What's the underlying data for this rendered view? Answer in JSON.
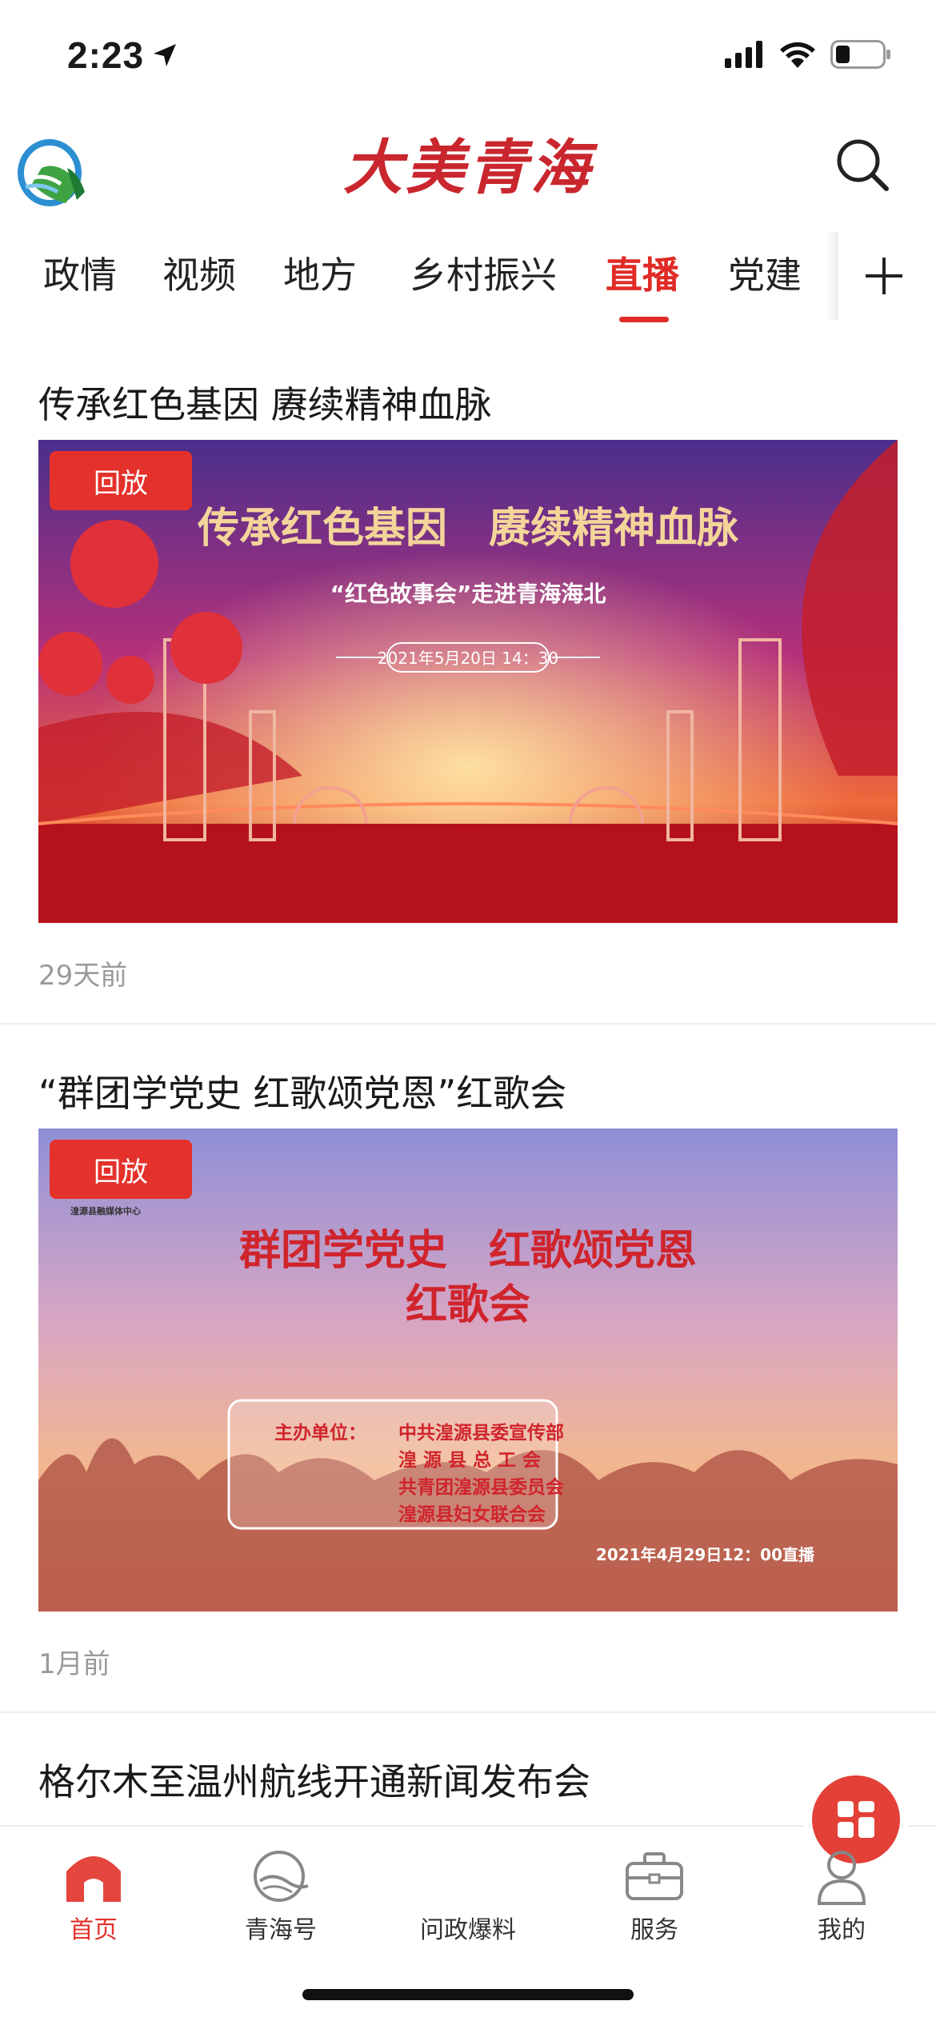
{
  "status_bar": {
    "time": "2:23"
  },
  "header": {
    "brand": "大美青海"
  },
  "tabs": [
    {
      "label": "政情"
    },
    {
      "label": "视频"
    },
    {
      "label": "地方"
    },
    {
      "label": "乡村振兴"
    },
    {
      "label": "直播"
    },
    {
      "label": "党建"
    }
  ],
  "active_tab": "直播",
  "feed": [
    {
      "title": "传承红色基因 赓续精神血脉",
      "badge": "回放",
      "time": "29天前",
      "banner": {
        "headline": "传承红色基因　赓续精神血脉",
        "subtitle": "“红色故事会”走进青海海北",
        "datetime": "2021年5月20日 14：30"
      }
    },
    {
      "title": "“群团学党史 红歌颂党恩”红歌会",
      "badge": "回放",
      "time": "1月前",
      "banner": {
        "org": "湟源县融媒体中心",
        "headline_1": "群团学党史　红歌颂党恩",
        "headline_2": "红歌会",
        "host_label": "主办单位：",
        "hosts": [
          "中共湟源县委宣传部",
          "湟 源 县 总 工 会",
          "共青团湟源县委员会",
          "湟源县妇女联合会"
        ],
        "datetime": "2021年4月29日12：00直播"
      }
    },
    {
      "title": "格尔木至温州航线开通新闻发布会"
    }
  ],
  "bottom_nav": [
    {
      "label": "首页",
      "icon": "home-icon",
      "active": true
    },
    {
      "label": "青海号",
      "icon": "qinghai-account-icon"
    },
    {
      "label": "问政爆料",
      "icon": "report-icon"
    },
    {
      "label": "服务",
      "icon": "briefcase-icon"
    },
    {
      "label": "我的",
      "icon": "user-icon"
    }
  ],
  "colors": {
    "accent": "#e02b26",
    "brand": "#c9262e"
  }
}
